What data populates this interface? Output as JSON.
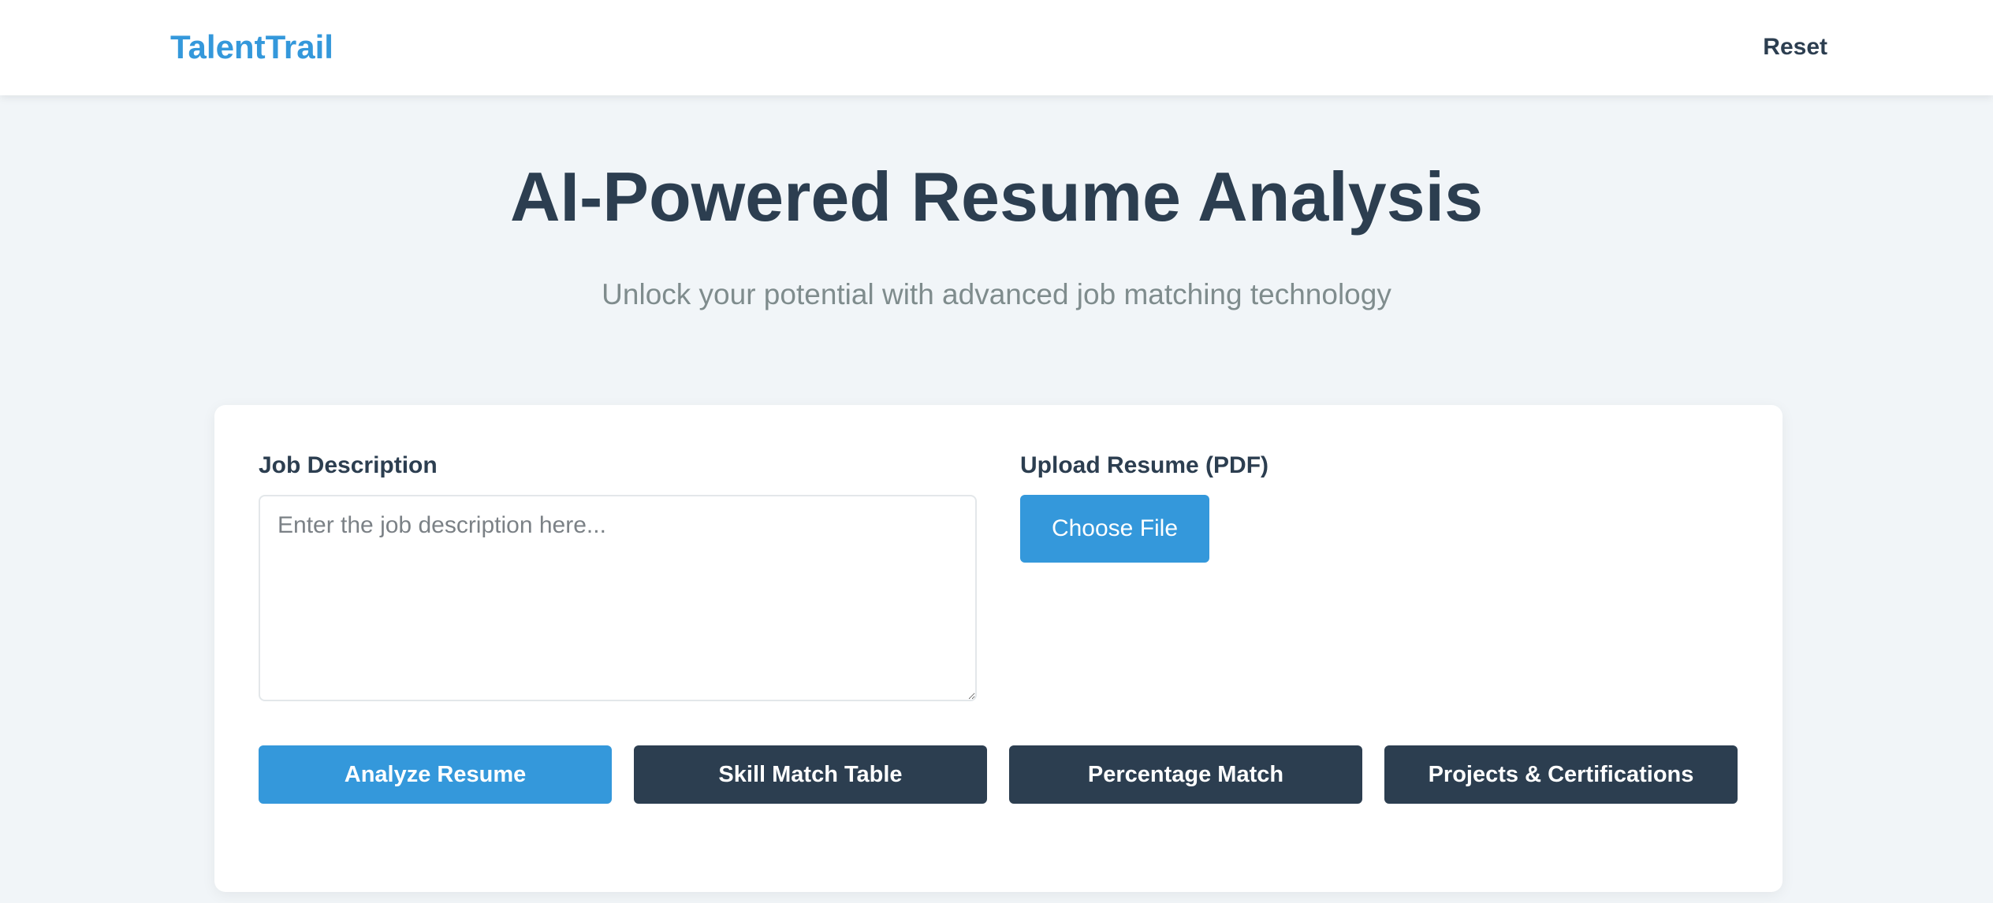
{
  "navbar": {
    "brand": "TalentTrail",
    "reset_label": "Reset"
  },
  "hero": {
    "title": "AI-Powered Resume Analysis",
    "subtitle": "Unlock your potential with advanced job matching technology"
  },
  "form": {
    "job_description": {
      "label": "Job Description",
      "value": "",
      "placeholder": "Enter the job description here..."
    },
    "upload": {
      "label": "Upload Resume (PDF)",
      "button_label": "Choose File"
    }
  },
  "actions": {
    "analyze_label": "Analyze Resume",
    "skill_match_label": "Skill Match Table",
    "percentage_label": "Percentage Match",
    "projects_label": "Projects & Certifications"
  },
  "colors": {
    "accent": "#3498db",
    "dark": "#2c3e50",
    "background": "#f1f5f8",
    "muted_text": "#7f8c8d"
  }
}
